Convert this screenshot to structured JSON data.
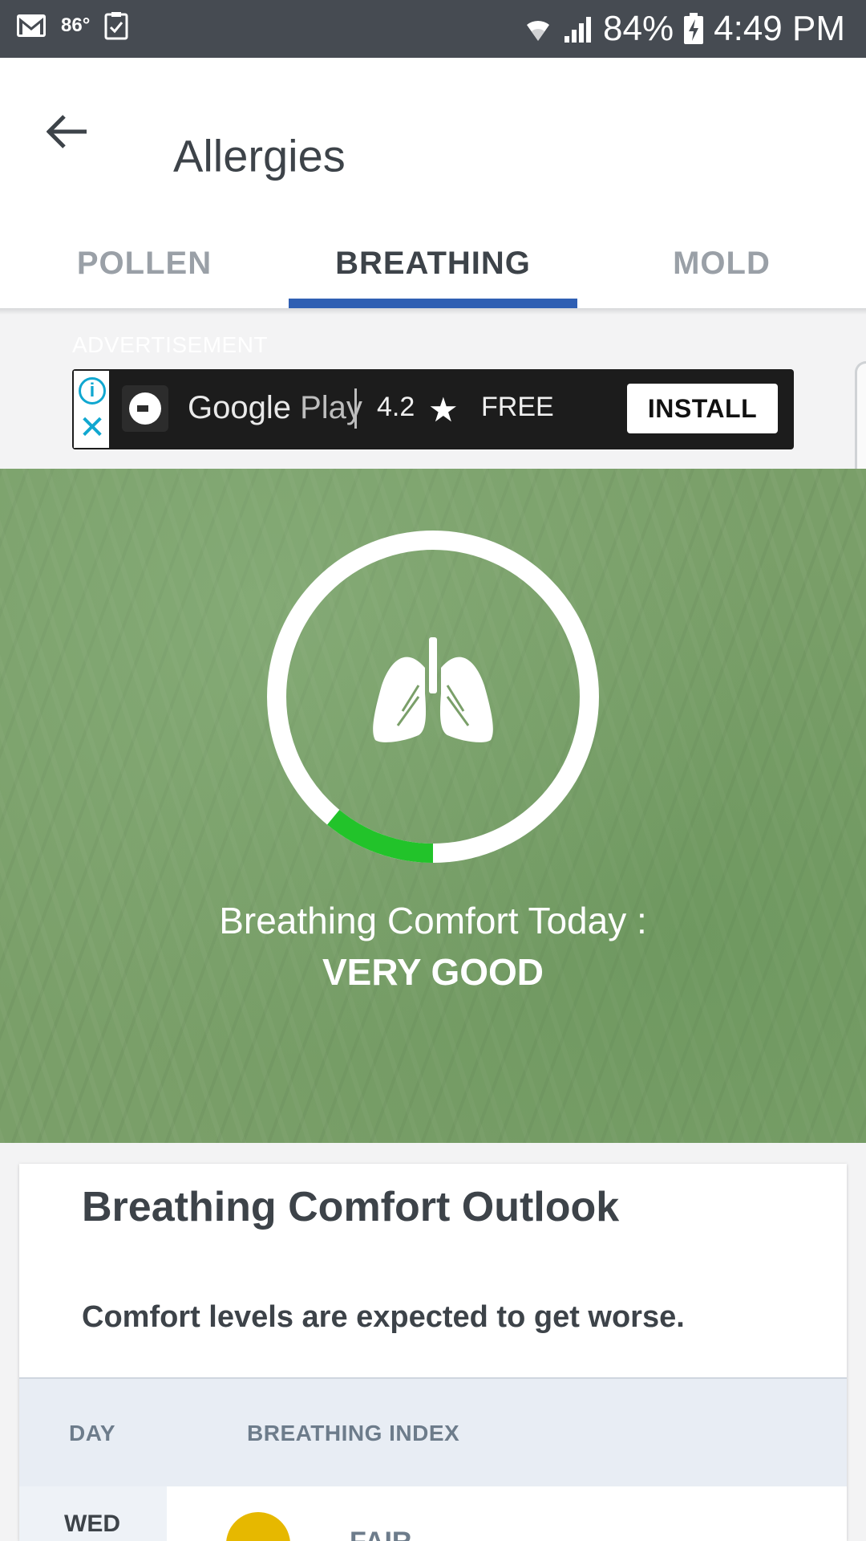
{
  "status_bar": {
    "temperature": "86°",
    "battery": "84%",
    "time": "4:49 PM"
  },
  "header": {
    "title": "Allergies",
    "back_icon": "arrow-left-icon"
  },
  "tabs": [
    {
      "label": "POLLEN",
      "active": false
    },
    {
      "label": "BREATHING",
      "active": true
    },
    {
      "label": "MOLD",
      "active": false
    }
  ],
  "ad": {
    "label": "ADVERTISEMENT",
    "store_name": "Google",
    "store_suffix": "Play",
    "rating": "4.2",
    "price": "FREE",
    "install_label": "INSTALL"
  },
  "hero": {
    "label": "Breathing Comfort Today :",
    "value": "VERY GOOD",
    "icon": "lungs-icon",
    "gauge_fraction": 0.11,
    "gauge_color": "#22c32a"
  },
  "outlook": {
    "title": "Breathing Comfort Outlook",
    "message": "Comfort levels are expected to get worse.",
    "columns": [
      "DAY",
      "BREATHING INDEX"
    ],
    "rows": [
      {
        "day": "WED",
        "level": "FAIR",
        "color": "#e6b800"
      }
    ]
  }
}
